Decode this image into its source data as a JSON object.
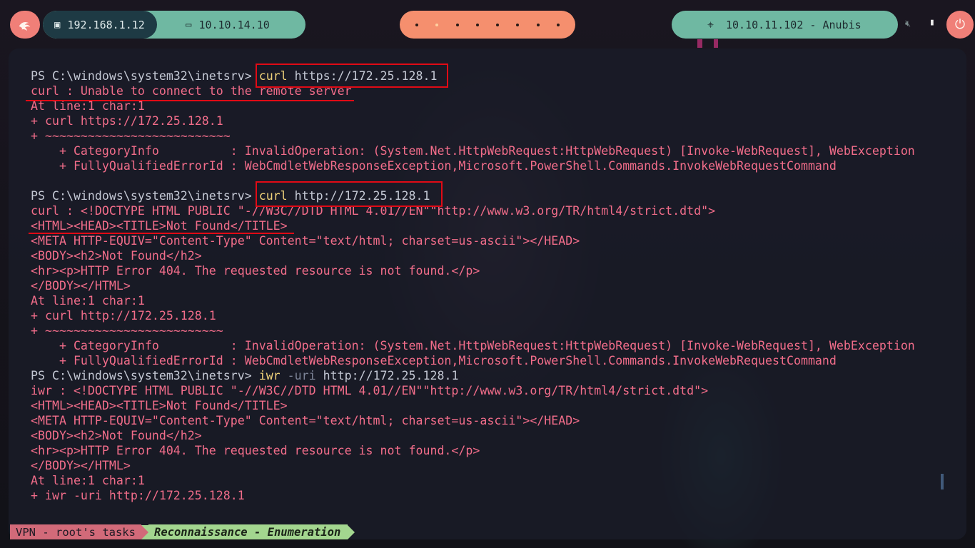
{
  "topbar": {
    "local_ip": "192.168.1.12",
    "vpn_ip": "10.10.14.10",
    "target": "10.10.11.102 - Anubis",
    "icons": {
      "menu": "kali-dragon-icon",
      "local": "ethernet-icon",
      "vpn": "laptop-icon",
      "target": "crosshair-icon",
      "mute": "volume-mute-icon",
      "battery": "battery-icon",
      "power": "power-icon"
    },
    "workspaces": 8,
    "active_workspace": 1
  },
  "terminal": {
    "lines": [
      [
        {
          "t": "PS C:\\windows\\system32\\inetsrv> ",
          "c": "prompt"
        },
        {
          "t": "curl",
          "c": "cmd"
        },
        {
          "t": " https://172.25.128.1",
          "c": "arg"
        }
      ],
      [
        {
          "t": "curl : Unable to connect to the remote server",
          "c": "err"
        }
      ],
      [
        {
          "t": "At line:1 char:1",
          "c": "err"
        }
      ],
      [
        {
          "t": "+ curl https://172.25.128.1",
          "c": "err"
        }
      ],
      [
        {
          "t": "+ ~~~~~~~~~~~~~~~~~~~~~~~~~~",
          "c": "err"
        }
      ],
      [
        {
          "t": "    + CategoryInfo          : InvalidOperation: (System.Net.HttpWebRequest:HttpWebRequest) [Invoke-WebRequest], WebException",
          "c": "err"
        }
      ],
      [
        {
          "t": "    + FullyQualifiedErrorId : WebCmdletWebResponseException,Microsoft.PowerShell.Commands.InvokeWebRequestCommand",
          "c": "err"
        }
      ],
      [
        {
          "t": " ",
          "c": "err"
        }
      ],
      [
        {
          "t": "PS C:\\windows\\system32\\inetsrv> ",
          "c": "prompt"
        },
        {
          "t": "curl",
          "c": "cmd"
        },
        {
          "t": " http://172.25.128.1",
          "c": "arg"
        }
      ],
      [
        {
          "t": "curl : <!DOCTYPE HTML PUBLIC \"-//W3C//DTD HTML 4.01//EN\"\"http://www.w3.org/TR/html4/strict.dtd\">",
          "c": "err"
        }
      ],
      [
        {
          "t": "<HTML><HEAD><TITLE>Not Found</TITLE>",
          "c": "err"
        }
      ],
      [
        {
          "t": "<META HTTP-EQUIV=\"Content-Type\" Content=\"text/html; charset=us-ascii\"></HEAD>",
          "c": "err"
        }
      ],
      [
        {
          "t": "<BODY><h2>Not Found</h2>",
          "c": "err"
        }
      ],
      [
        {
          "t": "<hr><p>HTTP Error 404. The requested resource is not found.</p>",
          "c": "err"
        }
      ],
      [
        {
          "t": "</BODY></HTML>",
          "c": "err"
        }
      ],
      [
        {
          "t": "At line:1 char:1",
          "c": "err"
        }
      ],
      [
        {
          "t": "+ curl http://172.25.128.1",
          "c": "err"
        }
      ],
      [
        {
          "t": "+ ~~~~~~~~~~~~~~~~~~~~~~~~~",
          "c": "err"
        }
      ],
      [
        {
          "t": "    + CategoryInfo          : InvalidOperation: (System.Net.HttpWebRequest:HttpWebRequest) [Invoke-WebRequest], WebException",
          "c": "err"
        }
      ],
      [
        {
          "t": "    + FullyQualifiedErrorId : WebCmdletWebResponseException,Microsoft.PowerShell.Commands.InvokeWebRequestCommand",
          "c": "err"
        }
      ],
      [
        {
          "t": "PS C:\\windows\\system32\\inetsrv> ",
          "c": "prompt"
        },
        {
          "t": "iwr",
          "c": "cmd"
        },
        {
          "t": " -uri",
          "c": "param"
        },
        {
          "t": " http://172.25.128.1",
          "c": "arg"
        }
      ],
      [
        {
          "t": "iwr : <!DOCTYPE HTML PUBLIC \"-//W3C//DTD HTML 4.01//EN\"\"http://www.w3.org/TR/html4/strict.dtd\">",
          "c": "err"
        }
      ],
      [
        {
          "t": "<HTML><HEAD><TITLE>Not Found</TITLE>",
          "c": "err"
        }
      ],
      [
        {
          "t": "<META HTTP-EQUIV=\"Content-Type\" Content=\"text/html; charset=us-ascii\"></HEAD>",
          "c": "err"
        }
      ],
      [
        {
          "t": "<BODY><h2>Not Found</h2>",
          "c": "err"
        }
      ],
      [
        {
          "t": "<hr><p>HTTP Error 404. The requested resource is not found.</p>",
          "c": "err"
        }
      ],
      [
        {
          "t": "</BODY></HTML>",
          "c": "err"
        }
      ],
      [
        {
          "t": "At line:1 char:1",
          "c": "err"
        }
      ],
      [
        {
          "t": "+ iwr -uri http://172.25.128.1",
          "c": "err"
        }
      ]
    ]
  },
  "statusbar": {
    "session": "VPN - root's tasks",
    "window": "Reconnaissance - Enumeration"
  },
  "colors": {
    "accent_salmon": "#f07f78",
    "accent_teal": "#6fb8a2",
    "error_text": "#f26d8a",
    "command": "#f0d27a",
    "highlight": "#e10a15"
  }
}
